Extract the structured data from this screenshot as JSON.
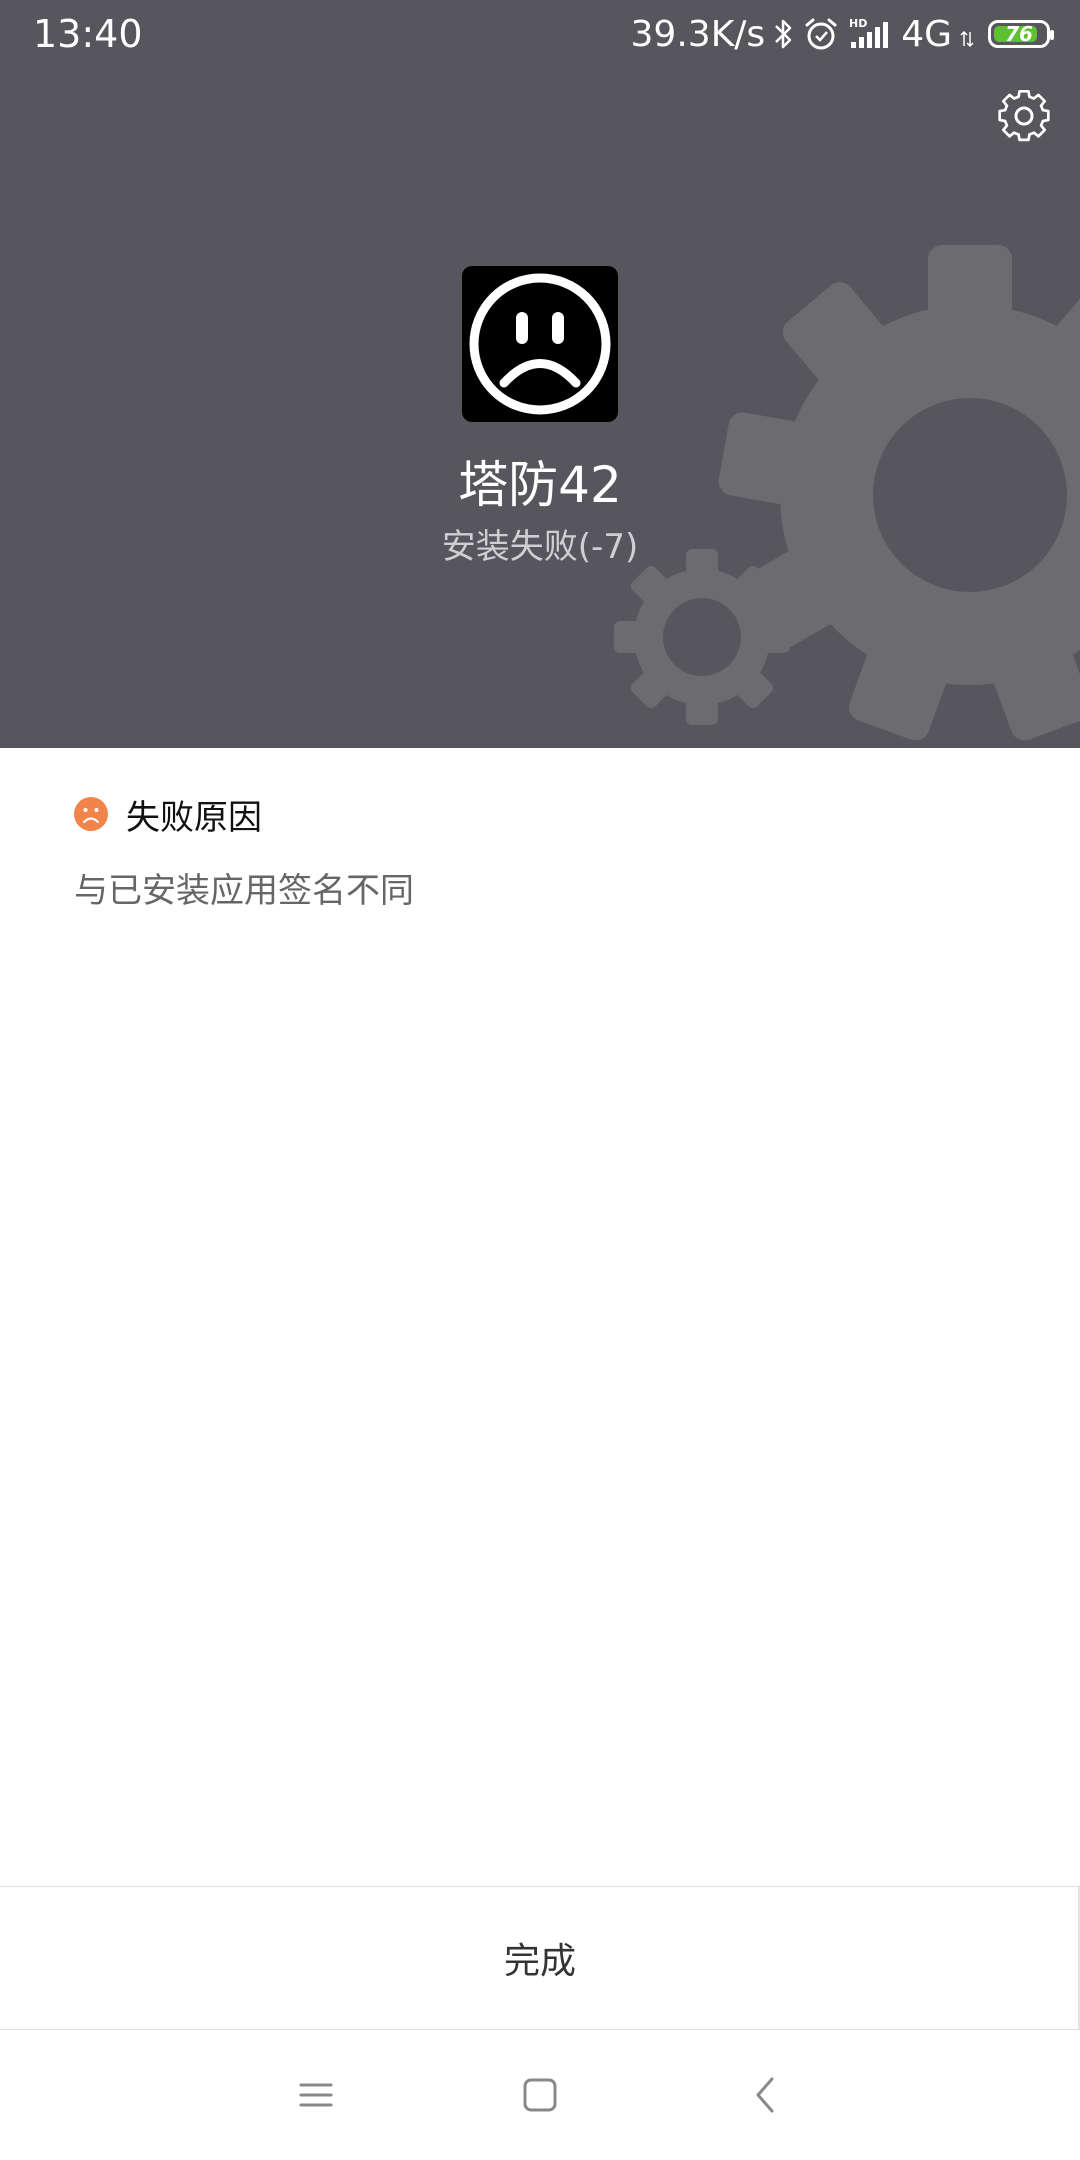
{
  "status_bar": {
    "time": "13:40",
    "net_speed": "39.3K/s",
    "network": "4G",
    "battery_level": "76",
    "icons": [
      "bluetooth-icon",
      "alarm-icon",
      "hd-signal-icon",
      "battery-icon"
    ]
  },
  "header": {
    "app_name": "塔防42",
    "install_status": "安装失败(-7)",
    "settings_icon": "gear-icon",
    "app_icon": "sad-face-icon"
  },
  "failure": {
    "title": "失败原因",
    "reason": "与已安装应用签名不同",
    "icon": "sad-face-icon"
  },
  "actions": {
    "done_label": "完成"
  },
  "nav_bar": {
    "icons": [
      "menu-icon",
      "home-icon",
      "back-icon"
    ]
  },
  "colors": {
    "header_bg": "#56565c",
    "gear_decoration": "#6b6b70",
    "failure_icon": "#f0844a",
    "battery": "#5ec22e"
  }
}
